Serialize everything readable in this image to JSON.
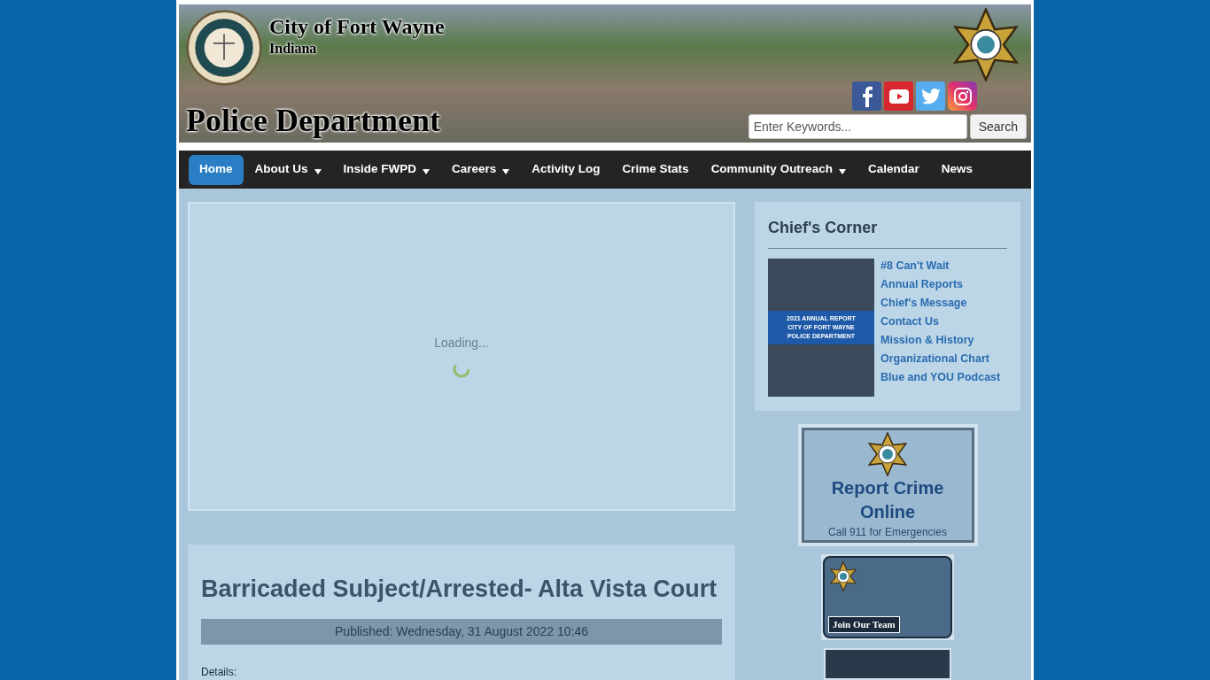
{
  "header": {
    "city": "City of Fort Wayne",
    "state": "Indiana",
    "department": "Police Department",
    "search": {
      "placeholder": "Enter Keywords...",
      "button": "Search"
    }
  },
  "nav": [
    {
      "label": "Home",
      "selected": true,
      "has_menu": false
    },
    {
      "label": "About Us",
      "selected": false,
      "has_menu": true
    },
    {
      "label": "Inside FWPD",
      "selected": false,
      "has_menu": true
    },
    {
      "label": "Careers",
      "selected": false,
      "has_menu": true
    },
    {
      "label": "Activity Log",
      "selected": false,
      "has_menu": false
    },
    {
      "label": "Crime Stats",
      "selected": false,
      "has_menu": false
    },
    {
      "label": "Community Outreach",
      "selected": false,
      "has_menu": true
    },
    {
      "label": "Calendar",
      "selected": false,
      "has_menu": false
    },
    {
      "label": "News",
      "selected": false,
      "has_menu": false
    }
  ],
  "slideshow": {
    "loading": "Loading..."
  },
  "article": {
    "title": "Barricaded Subject/Arrested- Alta Vista Court",
    "published": "Published: Wednesday, 31 August 2022 10:46",
    "details": "Details:"
  },
  "chiefs_corner": {
    "title": "Chief's Corner",
    "cover": [
      "2021 ANNUAL REPORT",
      "CITY OF FORT WAYNE",
      "POLICE DEPARTMENT"
    ],
    "links": [
      "#8 Can't Wait",
      "Annual Reports",
      "Chief's Message",
      "Contact Us",
      "Mission & History",
      "Organizational Chart",
      "Blue and YOU Podcast"
    ]
  },
  "report_banner": {
    "title": "Report Crime Online",
    "subtitle": "Call 911 for Emergencies"
  },
  "join_banner": {
    "label": "Join Our Team"
  }
}
